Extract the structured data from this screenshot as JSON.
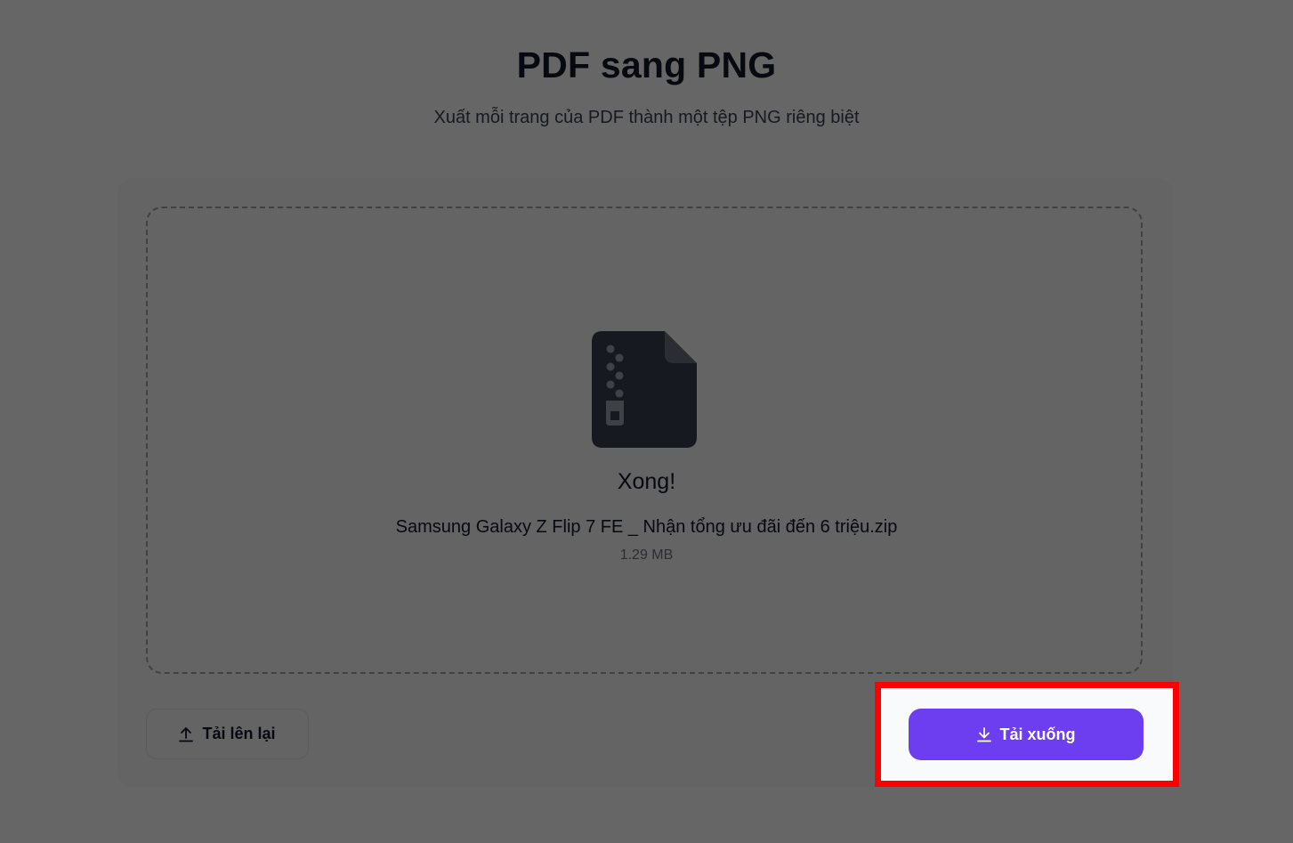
{
  "header": {
    "title": "PDF sang PNG",
    "subtitle": "Xuất mỗi trang của PDF thành một tệp PNG riêng biệt"
  },
  "result": {
    "icon": "zip-file-icon",
    "status": "Xong!",
    "file_name": "Samsung Galaxy Z Flip 7 FE _ Nhận tổng ưu đãi đến 6 triệu.zip",
    "file_size": "1.29 MB"
  },
  "actions": {
    "reupload_label": "Tải lên lại",
    "reupload_icon": "upload-icon",
    "download_label": "Tải xuống",
    "download_icon": "download-icon"
  },
  "colors": {
    "accent": "#6d3df0",
    "highlight": "#ff0000",
    "icon": "#374151"
  }
}
